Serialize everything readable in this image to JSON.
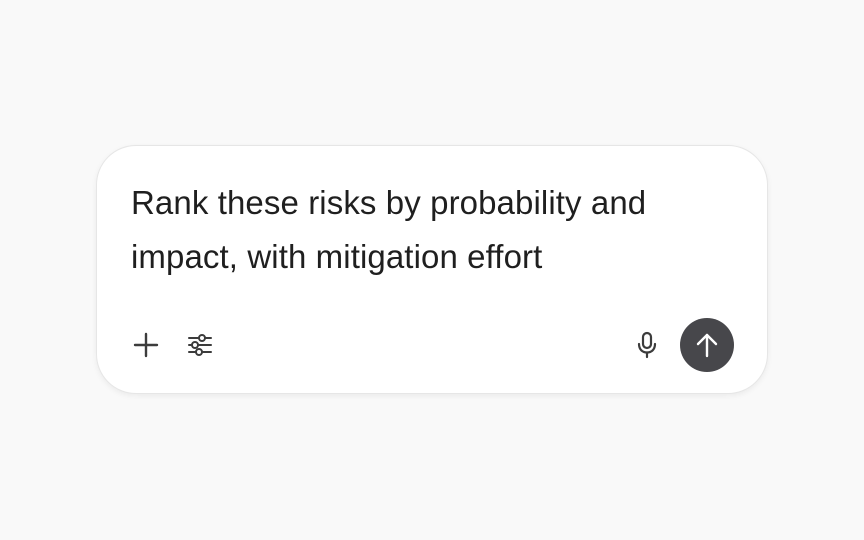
{
  "composer": {
    "text": "Rank these risks by probability and impact, with mitigation effort",
    "icons": {
      "add": "plus-icon",
      "tools": "sliders-icon",
      "voice": "microphone-icon",
      "send": "arrow-up-icon"
    },
    "colors": {
      "background": "#f9f9f9",
      "card": "#ffffff",
      "send_button": "#47474b",
      "icon": "#3c3c3c",
      "text": "#1f1f1f"
    }
  }
}
